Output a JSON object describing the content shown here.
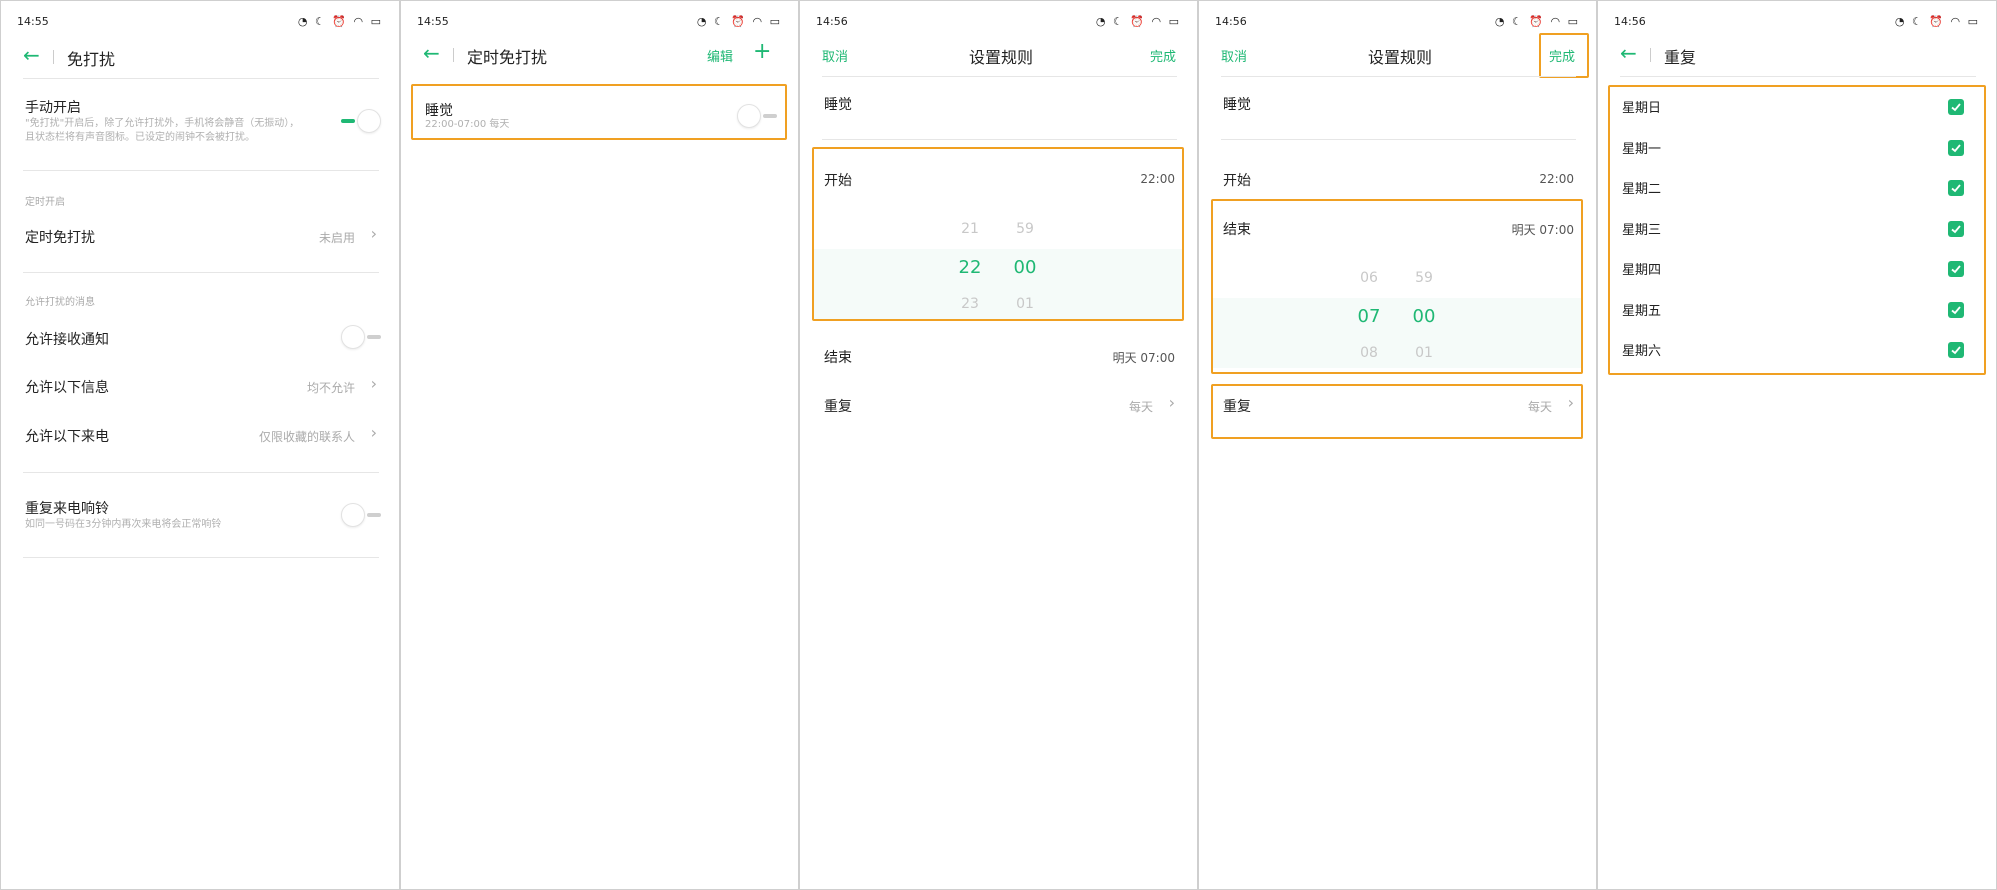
{
  "status": {
    "s1_time": "14:55",
    "s2_time": "14:55",
    "s3_time": "14:56",
    "s4_time": "14:56",
    "s5_time": "14:56",
    "icons": "◔ ☾ ⏰ ◠ ▭"
  },
  "s1": {
    "title": "免打扰",
    "manual_label": "手动开启",
    "manual_desc1": "\"免打扰\"开启后，除了允许打扰外，手机将会静音（无振动），",
    "manual_desc2": "且状态栏将有声音图标。已设定的闹钟不会被打扰。",
    "section_timed": "定时开启",
    "timed_label": "定时免打扰",
    "timed_value": "未启用",
    "section_allow": "允许打扰的消息",
    "allow_notify_label": "允许接收通知",
    "allow_msg_label": "允许以下信息",
    "allow_msg_value": "均不允许",
    "allow_call_label": "允许以下来电",
    "allow_call_value": "仅限收藏的联系人",
    "repeat_call_label": "重复来电响铃",
    "repeat_call_desc": "如同一号码在3分钟内再次来电将会正常响铃"
  },
  "s2": {
    "title": "定时免打扰",
    "edit": "编辑",
    "rule_name": "睡觉",
    "rule_time": "22:00-07:00 每天"
  },
  "s3": {
    "cancel": "取消",
    "title": "设置规则",
    "done": "完成",
    "name": "睡觉",
    "start_label": "开始",
    "start_value": "22:00",
    "h_prev": "21",
    "h_sel": "22",
    "h_next": "23",
    "m_prev": "59",
    "m_sel": "00",
    "m_next": "01",
    "end_label": "结束",
    "end_value": "明天 07:00",
    "repeat_label": "重复",
    "repeat_value": "每天"
  },
  "s4": {
    "cancel": "取消",
    "title": "设置规则",
    "done": "完成",
    "name": "睡觉",
    "start_label": "开始",
    "start_value": "22:00",
    "end_label": "结束",
    "end_value": "明天 07:00",
    "h_prev": "06",
    "h_sel": "07",
    "h_next": "08",
    "m_prev": "59",
    "m_sel": "00",
    "m_next": "01",
    "repeat_label": "重复",
    "repeat_value": "每天"
  },
  "s5": {
    "title": "重复",
    "days": [
      "星期日",
      "星期一",
      "星期二",
      "星期三",
      "星期四",
      "星期五",
      "星期六"
    ]
  },
  "colors": {
    "accent": "#1fb874",
    "highlight": "#f0a022"
  }
}
